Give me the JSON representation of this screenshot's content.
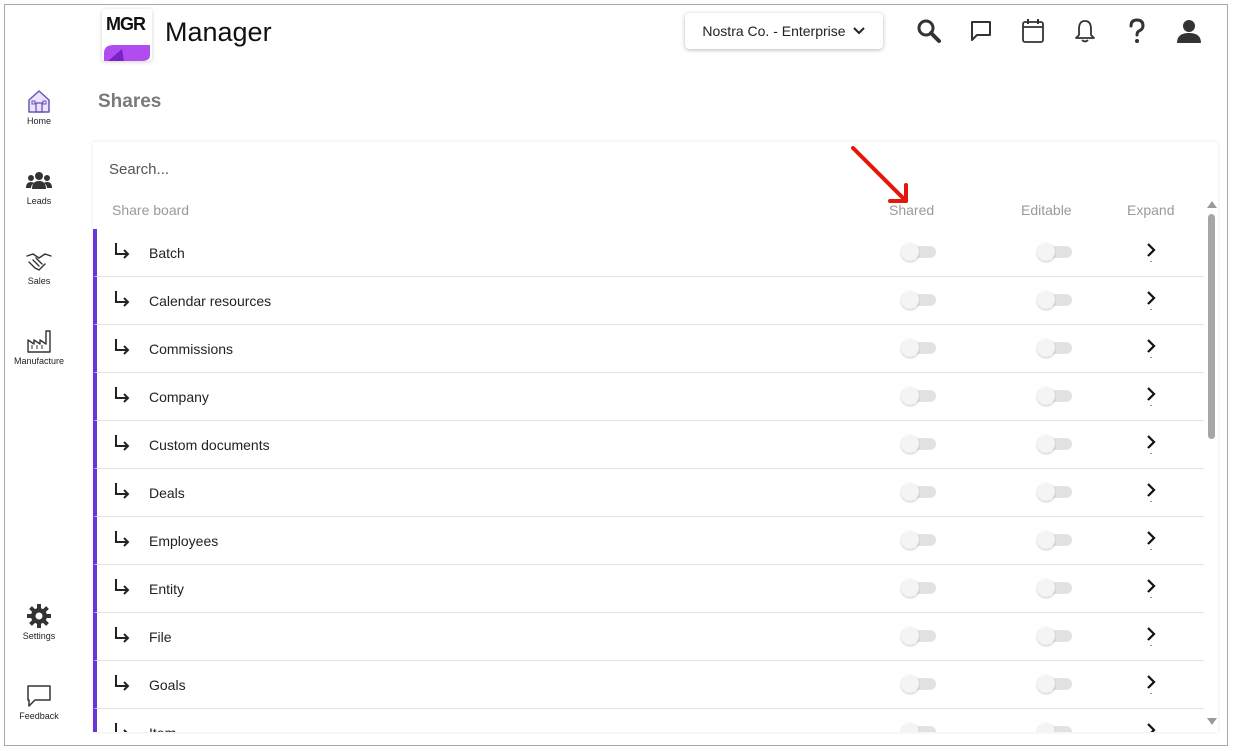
{
  "app": {
    "logo_text": "MGR",
    "title": "Manager"
  },
  "header": {
    "organization": "Nostra Co. - Enterprise",
    "icons": [
      "search-icon",
      "chat-icon",
      "calendar-icon",
      "bell-icon",
      "help-icon",
      "user-icon"
    ]
  },
  "nav": {
    "items": [
      {
        "label": "Home",
        "icon": "home-icon"
      },
      {
        "label": "Leads",
        "icon": "people-icon"
      },
      {
        "label": "Sales",
        "icon": "handshake-icon"
      },
      {
        "label": "Manufacture",
        "icon": "factory-icon"
      }
    ],
    "bottom": [
      {
        "label": "Settings",
        "icon": "gear-icon"
      },
      {
        "label": "Feedback",
        "icon": "feedback-icon"
      }
    ]
  },
  "page": {
    "title": "Shares"
  },
  "table": {
    "search_placeholder": "Search...",
    "columns": {
      "name": "Share board",
      "shared": "Shared",
      "editable": "Editable",
      "expand": "Expand"
    },
    "rows": [
      {
        "label": "Batch",
        "shared": false,
        "editable": false
      },
      {
        "label": "Calendar resources",
        "shared": false,
        "editable": false
      },
      {
        "label": "Commissions",
        "shared": false,
        "editable": false
      },
      {
        "label": "Company",
        "shared": false,
        "editable": false
      },
      {
        "label": "Custom documents",
        "shared": false,
        "editable": false
      },
      {
        "label": "Deals",
        "shared": false,
        "editable": false
      },
      {
        "label": "Employees",
        "shared": false,
        "editable": false
      },
      {
        "label": "Entity",
        "shared": false,
        "editable": false
      },
      {
        "label": "File",
        "shared": false,
        "editable": false
      },
      {
        "label": "Goals",
        "shared": false,
        "editable": false
      },
      {
        "label": "Item",
        "shared": false,
        "editable": false
      }
    ]
  },
  "colors": {
    "accent": "#6a35d8",
    "logo_purple": "#b04cf0",
    "annotation_arrow": "#e3170a",
    "toggle_off": "#e2e2e2"
  }
}
